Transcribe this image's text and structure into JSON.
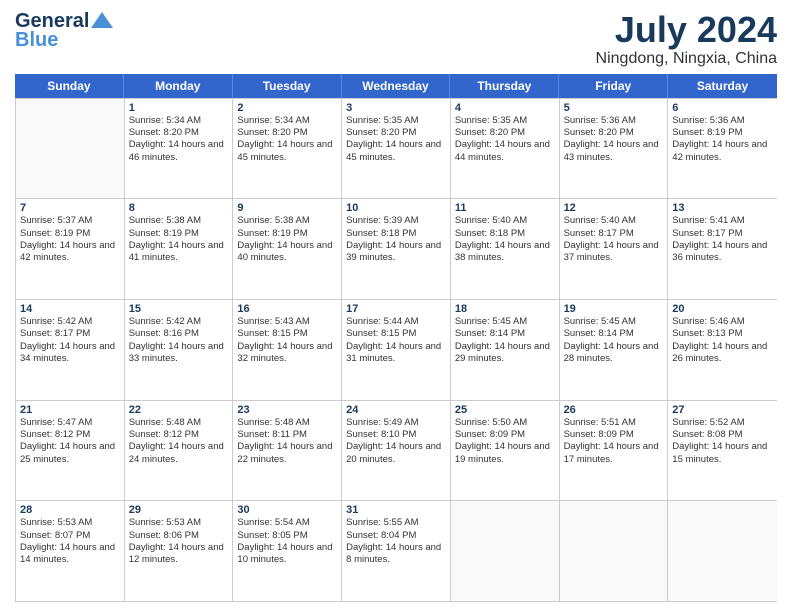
{
  "logo": {
    "line1": "General",
    "line2": "Blue"
  },
  "title": "July 2024",
  "subtitle": "Ningdong, Ningxia, China",
  "days": [
    "Sunday",
    "Monday",
    "Tuesday",
    "Wednesday",
    "Thursday",
    "Friday",
    "Saturday"
  ],
  "weeks": [
    [
      {
        "day": "",
        "sunrise": "",
        "sunset": "",
        "daylight": "",
        "empty": true
      },
      {
        "day": "1",
        "sunrise": "Sunrise: 5:34 AM",
        "sunset": "Sunset: 8:20 PM",
        "daylight": "Daylight: 14 hours and 46 minutes."
      },
      {
        "day": "2",
        "sunrise": "Sunrise: 5:34 AM",
        "sunset": "Sunset: 8:20 PM",
        "daylight": "Daylight: 14 hours and 45 minutes."
      },
      {
        "day": "3",
        "sunrise": "Sunrise: 5:35 AM",
        "sunset": "Sunset: 8:20 PM",
        "daylight": "Daylight: 14 hours and 45 minutes."
      },
      {
        "day": "4",
        "sunrise": "Sunrise: 5:35 AM",
        "sunset": "Sunset: 8:20 PM",
        "daylight": "Daylight: 14 hours and 44 minutes."
      },
      {
        "day": "5",
        "sunrise": "Sunrise: 5:36 AM",
        "sunset": "Sunset: 8:20 PM",
        "daylight": "Daylight: 14 hours and 43 minutes."
      },
      {
        "day": "6",
        "sunrise": "Sunrise: 5:36 AM",
        "sunset": "Sunset: 8:19 PM",
        "daylight": "Daylight: 14 hours and 42 minutes."
      }
    ],
    [
      {
        "day": "7",
        "sunrise": "Sunrise: 5:37 AM",
        "sunset": "Sunset: 8:19 PM",
        "daylight": "Daylight: 14 hours and 42 minutes."
      },
      {
        "day": "8",
        "sunrise": "Sunrise: 5:38 AM",
        "sunset": "Sunset: 8:19 PM",
        "daylight": "Daylight: 14 hours and 41 minutes."
      },
      {
        "day": "9",
        "sunrise": "Sunrise: 5:38 AM",
        "sunset": "Sunset: 8:19 PM",
        "daylight": "Daylight: 14 hours and 40 minutes."
      },
      {
        "day": "10",
        "sunrise": "Sunrise: 5:39 AM",
        "sunset": "Sunset: 8:18 PM",
        "daylight": "Daylight: 14 hours and 39 minutes."
      },
      {
        "day": "11",
        "sunrise": "Sunrise: 5:40 AM",
        "sunset": "Sunset: 8:18 PM",
        "daylight": "Daylight: 14 hours and 38 minutes."
      },
      {
        "day": "12",
        "sunrise": "Sunrise: 5:40 AM",
        "sunset": "Sunset: 8:17 PM",
        "daylight": "Daylight: 14 hours and 37 minutes."
      },
      {
        "day": "13",
        "sunrise": "Sunrise: 5:41 AM",
        "sunset": "Sunset: 8:17 PM",
        "daylight": "Daylight: 14 hours and 36 minutes."
      }
    ],
    [
      {
        "day": "14",
        "sunrise": "Sunrise: 5:42 AM",
        "sunset": "Sunset: 8:17 PM",
        "daylight": "Daylight: 14 hours and 34 minutes."
      },
      {
        "day": "15",
        "sunrise": "Sunrise: 5:42 AM",
        "sunset": "Sunset: 8:16 PM",
        "daylight": "Daylight: 14 hours and 33 minutes."
      },
      {
        "day": "16",
        "sunrise": "Sunrise: 5:43 AM",
        "sunset": "Sunset: 8:15 PM",
        "daylight": "Daylight: 14 hours and 32 minutes."
      },
      {
        "day": "17",
        "sunrise": "Sunrise: 5:44 AM",
        "sunset": "Sunset: 8:15 PM",
        "daylight": "Daylight: 14 hours and 31 minutes."
      },
      {
        "day": "18",
        "sunrise": "Sunrise: 5:45 AM",
        "sunset": "Sunset: 8:14 PM",
        "daylight": "Daylight: 14 hours and 29 minutes."
      },
      {
        "day": "19",
        "sunrise": "Sunrise: 5:45 AM",
        "sunset": "Sunset: 8:14 PM",
        "daylight": "Daylight: 14 hours and 28 minutes."
      },
      {
        "day": "20",
        "sunrise": "Sunrise: 5:46 AM",
        "sunset": "Sunset: 8:13 PM",
        "daylight": "Daylight: 14 hours and 26 minutes."
      }
    ],
    [
      {
        "day": "21",
        "sunrise": "Sunrise: 5:47 AM",
        "sunset": "Sunset: 8:12 PM",
        "daylight": "Daylight: 14 hours and 25 minutes."
      },
      {
        "day": "22",
        "sunrise": "Sunrise: 5:48 AM",
        "sunset": "Sunset: 8:12 PM",
        "daylight": "Daylight: 14 hours and 24 minutes."
      },
      {
        "day": "23",
        "sunrise": "Sunrise: 5:48 AM",
        "sunset": "Sunset: 8:11 PM",
        "daylight": "Daylight: 14 hours and 22 minutes."
      },
      {
        "day": "24",
        "sunrise": "Sunrise: 5:49 AM",
        "sunset": "Sunset: 8:10 PM",
        "daylight": "Daylight: 14 hours and 20 minutes."
      },
      {
        "day": "25",
        "sunrise": "Sunrise: 5:50 AM",
        "sunset": "Sunset: 8:09 PM",
        "daylight": "Daylight: 14 hours and 19 minutes."
      },
      {
        "day": "26",
        "sunrise": "Sunrise: 5:51 AM",
        "sunset": "Sunset: 8:09 PM",
        "daylight": "Daylight: 14 hours and 17 minutes."
      },
      {
        "day": "27",
        "sunrise": "Sunrise: 5:52 AM",
        "sunset": "Sunset: 8:08 PM",
        "daylight": "Daylight: 14 hours and 15 minutes."
      }
    ],
    [
      {
        "day": "28",
        "sunrise": "Sunrise: 5:53 AM",
        "sunset": "Sunset: 8:07 PM",
        "daylight": "Daylight: 14 hours and 14 minutes."
      },
      {
        "day": "29",
        "sunrise": "Sunrise: 5:53 AM",
        "sunset": "Sunset: 8:06 PM",
        "daylight": "Daylight: 14 hours and 12 minutes."
      },
      {
        "day": "30",
        "sunrise": "Sunrise: 5:54 AM",
        "sunset": "Sunset: 8:05 PM",
        "daylight": "Daylight: 14 hours and 10 minutes."
      },
      {
        "day": "31",
        "sunrise": "Sunrise: 5:55 AM",
        "sunset": "Sunset: 8:04 PM",
        "daylight": "Daylight: 14 hours and 8 minutes."
      },
      {
        "day": "",
        "sunrise": "",
        "sunset": "",
        "daylight": "",
        "empty": true
      },
      {
        "day": "",
        "sunrise": "",
        "sunset": "",
        "daylight": "",
        "empty": true
      },
      {
        "day": "",
        "sunrise": "",
        "sunset": "",
        "daylight": "",
        "empty": true
      }
    ]
  ]
}
